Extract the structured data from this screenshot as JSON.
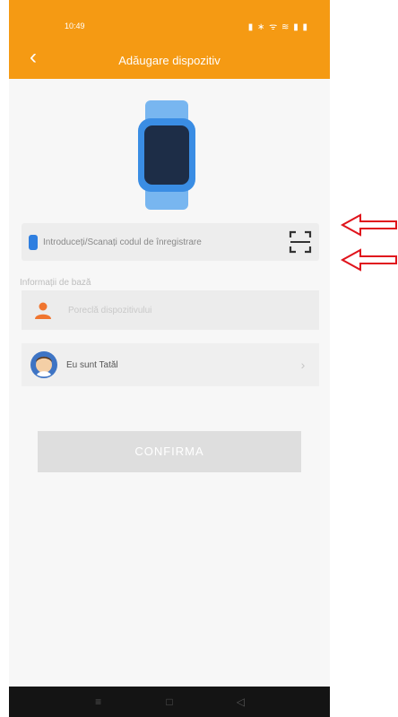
{
  "status_bar": {
    "time": "10:49",
    "icons": "▮ ∗ ᯤ ≋ ▮ ▮"
  },
  "header": {
    "title": "Adăugare dispozitiv"
  },
  "code_input": {
    "placeholder": "Introduceți/Scanați codul de înregistrare"
  },
  "basic_info": {
    "section_label": "Informații de bază",
    "nickname_placeholder": "Poreclă dispozitivului",
    "relation_label": "Eu sunt Tatăl"
  },
  "confirm": {
    "label": "CONFIRMA"
  },
  "colors": {
    "accent": "#f59a13",
    "annotation": "#e0141c"
  }
}
